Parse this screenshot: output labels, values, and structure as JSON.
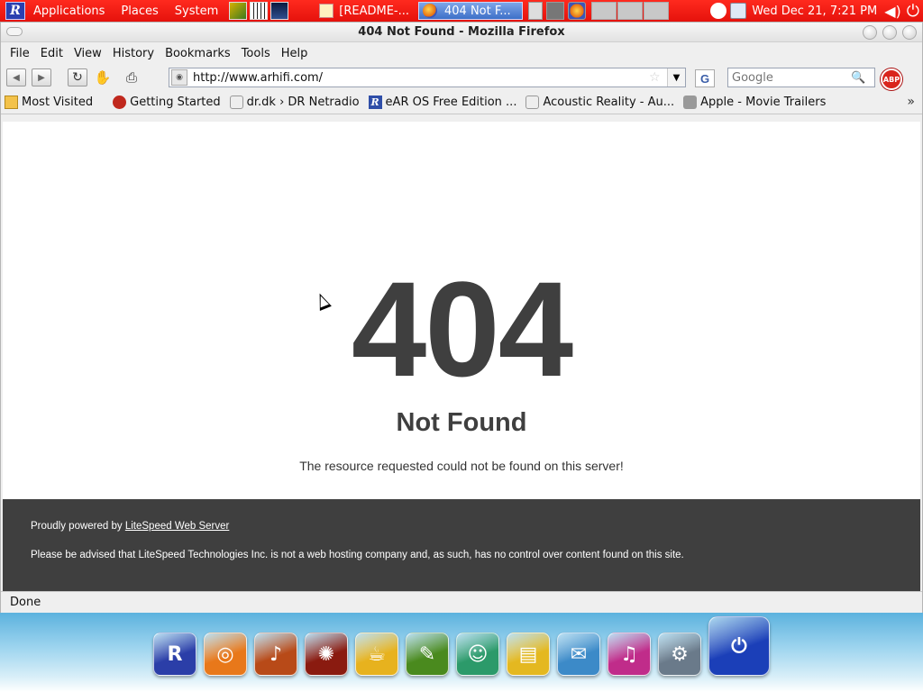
{
  "top_panel": {
    "menus": [
      "Applications",
      "Places",
      "System"
    ],
    "tasks": [
      {
        "label": "[README-..."
      },
      {
        "label": "404 Not F..."
      }
    ],
    "clock": "Wed Dec 21,  7:21 PM"
  },
  "window": {
    "title": "404 Not Found - Mozilla Firefox"
  },
  "menubar": [
    "File",
    "Edit",
    "View",
    "History",
    "Bookmarks",
    "Tools",
    "Help"
  ],
  "navbar": {
    "url": "http://www.arhifi.com/",
    "search_placeholder": "Google",
    "search_engine_letter": "G",
    "adblock_label": "ABP"
  },
  "bookmarks": [
    {
      "label": "Most Visited",
      "icon": "folder-icon"
    },
    {
      "label": "Getting Started",
      "icon": "firefox-bookmark-icon"
    },
    {
      "label": "dr.dk › DR Netradio",
      "icon": "page-icon"
    },
    {
      "label": "eAR OS Free Edition ...",
      "icon": "ear-os-icon"
    },
    {
      "label": "Acoustic Reality - Au...",
      "icon": "page-icon"
    },
    {
      "label": "Apple - Movie Trailers",
      "icon": "apple-icon"
    }
  ],
  "page": {
    "code": "404",
    "title": "Not Found",
    "description": "The resource requested could not be found on this server!",
    "footer": {
      "powered_prefix": "Proudly powered by ",
      "powered_link": "LiteSpeed Web Server",
      "advisory": "Please be advised that LiteSpeed Technologies Inc. is not a web hosting company and, as such, has no control over content found on this site."
    }
  },
  "status": "Done",
  "dock": [
    {
      "name": "rpm-app-icon",
      "color": "#2b3ea8"
    },
    {
      "name": "firefox-icon",
      "color": "#e8781a"
    },
    {
      "name": "guitar-icon",
      "color": "#b84a18"
    },
    {
      "name": "fire-icon",
      "color": "#8a1b10"
    },
    {
      "name": "coffee-cup-icon",
      "color": "#e7b21e"
    },
    {
      "name": "image-editor-icon",
      "color": "#4a8a1e"
    },
    {
      "name": "messenger-icon",
      "color": "#2c9a6a"
    },
    {
      "name": "office-icon",
      "color": "#e4b820"
    },
    {
      "name": "mail-feather-icon",
      "color": "#3c8ac8"
    },
    {
      "name": "music-icon",
      "color": "#c02c8a"
    },
    {
      "name": "settings-icon",
      "color": "#6a7a8a"
    },
    {
      "name": "power-icon",
      "color": "#1b3fb8"
    }
  ]
}
